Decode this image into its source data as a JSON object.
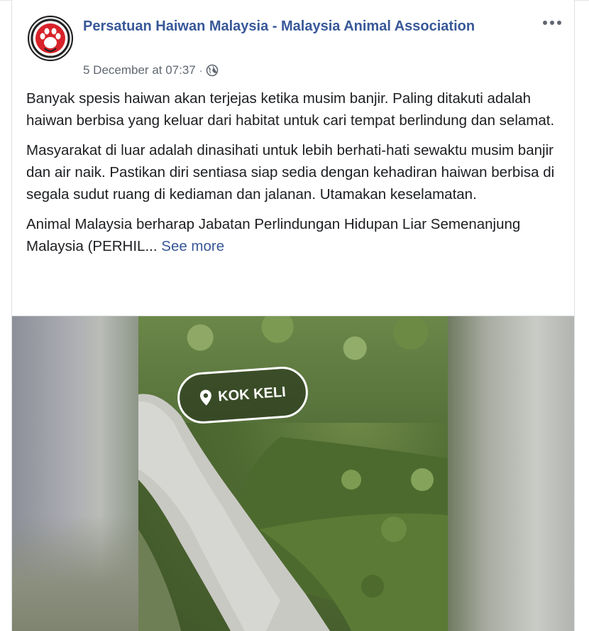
{
  "post": {
    "page_name": "Persatuan Haiwan Malaysia - Malaysia Animal Association",
    "timestamp": "5 December at 07:37",
    "separator": "·",
    "privacy_icon": "globe-icon",
    "more_icon": "more-options-icon",
    "paragraphs": [
      "Banyak spesis haiwan akan terjejas ketika musim banjir. Paling ditakuti adalah haiwan berbisa yang keluar dari habitat untuk cari tempat berlindung dan selamat.",
      "Masyarakat di luar adalah dinasihati untuk lebih berhati-hati sewaktu musim banjir dan air naik. Pastikan diri sentiasa siap sedia dengan kehadiran haiwan berbisa di segala sudut ruang di kediaman dan jalanan. Utamakan keselamatan."
    ],
    "truncated_paragraph": "Animal Malaysia berharap Jabatan Perlindungan Hidupan Liar Semenanjung Malaysia (PERHIL...",
    "see_more_label": "See more"
  },
  "media": {
    "location_label": "KOK KELI",
    "location_icon": "map-pin-icon"
  },
  "colors": {
    "link": "#385898",
    "text": "#1c1e21",
    "meta": "#606770",
    "logo_red": "#d8232a"
  }
}
